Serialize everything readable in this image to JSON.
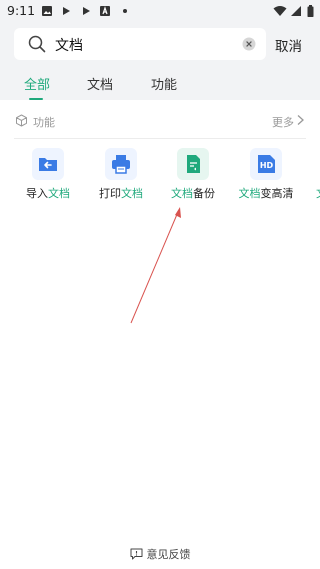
{
  "status_bar": {
    "time": "9:11"
  },
  "search": {
    "query": "文档",
    "cancel_label": "取消"
  },
  "tabs": [
    {
      "label": "全部",
      "active": true
    },
    {
      "label": "文档",
      "active": false
    },
    {
      "label": "功能",
      "active": false
    }
  ],
  "section": {
    "title": "功能",
    "more_label": "更多"
  },
  "features": [
    {
      "label_pre": "导入",
      "label_hl": "文档",
      "label_post": "",
      "icon": "import-icon"
    },
    {
      "label_pre": "打印",
      "label_hl": "文档",
      "label_post": "",
      "icon": "printer-icon"
    },
    {
      "label_pre": "",
      "label_hl": "文档",
      "label_post": "备份",
      "icon": "backup-doc-icon"
    },
    {
      "label_pre": "",
      "label_hl": "文档",
      "label_post": "变高清",
      "icon": "hd-icon"
    }
  ],
  "footer": {
    "feedback_label": "意见反馈"
  },
  "colors": {
    "accent": "#1fa97c",
    "arrow": "#d9534f"
  }
}
